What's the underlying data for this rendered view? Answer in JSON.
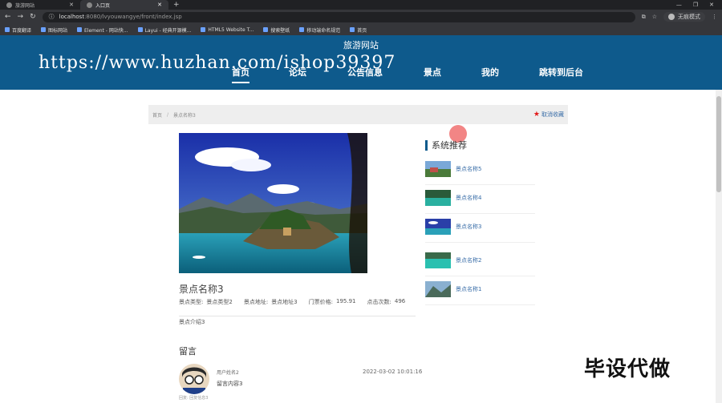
{
  "browser": {
    "tabs": [
      {
        "label": "旅游网站",
        "active": false
      },
      {
        "label": "入口页",
        "active": true
      }
    ],
    "url_host": "localhost",
    "url_rest": ":8080/lvyouwangye/front/index.jsp",
    "profile_label": "无痕模式",
    "bookmarks": [
      "百度翻译",
      "图标网站",
      "Element - 网站快...",
      "Layui - 经典开源模...",
      "HTML5 Website T...",
      "搜索壁纸",
      "移动端命名规范",
      "首页"
    ]
  },
  "site": {
    "title": "旅游网站",
    "watermark": "https://www.huzhan.com/ishop39397",
    "nav": [
      "首页",
      "论坛",
      "公告信息",
      "景点",
      "我的",
      "跳转到后台"
    ]
  },
  "breadcrumb": {
    "home": "首页",
    "separator": "/",
    "current": "景点名称3",
    "favorite_label": "取消收藏"
  },
  "detail": {
    "name": "景点名称3",
    "type_label": "景点类型:",
    "type_value": "景点类型2",
    "address_label": "景点地址:",
    "address_value": "景点地址3",
    "price_label": "门票价格:",
    "price_value": "195.91",
    "clicks_label": "点击次数:",
    "clicks_value": "496",
    "intro": "景点介绍3"
  },
  "messages": {
    "title": "留言",
    "user": "用户姓名2",
    "time": "2022-03-02 10:01:16",
    "content": "留言内容3",
    "reply": "回复:  回复信息3"
  },
  "recommend": {
    "title": "系统推荐",
    "items": [
      "景点名称5",
      "景点名称4",
      "景点名称3",
      "景点名称2",
      "景点名称1"
    ]
  },
  "promo": "毕设代做",
  "colors": {
    "header": "#0e5a8c",
    "link": "#3a6ea8",
    "star": "#e21a1a"
  }
}
